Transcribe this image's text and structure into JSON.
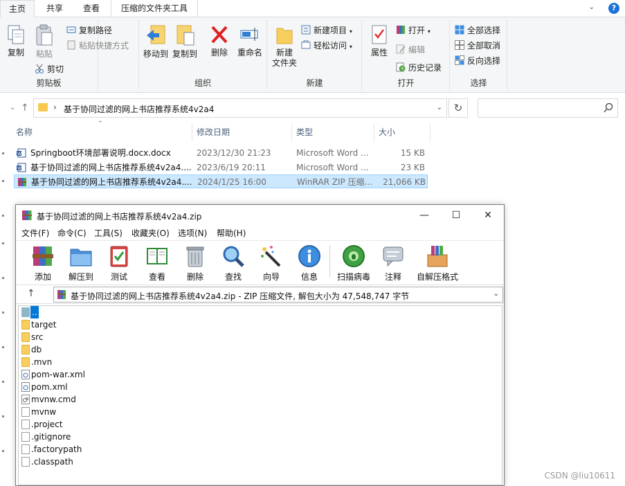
{
  "ribbon_tabs": [
    "主页",
    "共享",
    "查看",
    "压缩的文件夹工具"
  ],
  "ribbon": {
    "clipboard": {
      "copy": "复制",
      "paste": "粘贴",
      "copy_path": "复制路径",
      "paste_shortcut": "粘贴快捷方式",
      "cut": "剪切",
      "label": "剪贴板"
    },
    "organize": {
      "move_to": "移动到",
      "copy_to": "复制到",
      "delete": "删除",
      "rename": "重命名",
      "label": "组织"
    },
    "new": {
      "new_folder_line1": "新建",
      "new_folder_line2": "文件夹",
      "new_item": "新建项目",
      "easy_access": "轻松访问",
      "label": "新建"
    },
    "open": {
      "properties": "属性",
      "open": "打开",
      "edit": "编辑",
      "history": "历史记录",
      "label": "打开"
    },
    "select": {
      "select_all": "全部选择",
      "select_none": "全部取消",
      "invert": "反向选择",
      "label": "选择"
    }
  },
  "address": {
    "path": "基于协同过滤的网上书店推荐系统4v2a4",
    "separator": "›"
  },
  "columns": {
    "name": "名称",
    "modified": "修改日期",
    "type": "类型",
    "size": "大小"
  },
  "files": [
    {
      "name": "Springboot环境部署说明.docx.docx",
      "modified": "2023/12/30 21:23",
      "type": "Microsoft Word ...",
      "size": "15 KB"
    },
    {
      "name": "基于协同过滤的网上书店推荐系统4v2a4....",
      "modified": "2023/6/19 20:11",
      "type": "Microsoft Word ...",
      "size": "23 KB"
    },
    {
      "name": "基于协同过滤的网上书店推荐系统4v2a4....",
      "modified": "2024/1/25 16:00",
      "type": "WinRAR ZIP 压缩...",
      "size": "21,066 KB"
    }
  ],
  "winrar": {
    "title": "基于协同过滤的网上书店推荐系统4v2a4.zip",
    "menu": [
      "文件(F)",
      "命令(C)",
      "工具(S)",
      "收藏夹(O)",
      "选项(N)",
      "帮助(H)"
    ],
    "tools": [
      "添加",
      "解压到",
      "测试",
      "查看",
      "删除",
      "查找",
      "向导",
      "信息",
      "扫描病毒",
      "注释",
      "自解压格式"
    ],
    "path_text": "基于协同过滤的网上书店推荐系统4v2a4.zip - ZIP 压缩文件, 解包大小为 47,548,747 字节",
    "items": [
      {
        "name": "..",
        "kind": "up"
      },
      {
        "name": "target",
        "kind": "folder"
      },
      {
        "name": "src",
        "kind": "folder"
      },
      {
        "name": "db",
        "kind": "folder"
      },
      {
        "name": ".mvn",
        "kind": "folder"
      },
      {
        "name": "pom-war.xml",
        "kind": "xml"
      },
      {
        "name": "pom.xml",
        "kind": "xml"
      },
      {
        "name": "mvnw.cmd",
        "kind": "cmd"
      },
      {
        "name": "mvnw",
        "kind": "file"
      },
      {
        "name": ".project",
        "kind": "file"
      },
      {
        "name": ".gitignore",
        "kind": "file"
      },
      {
        "name": ".factorypath",
        "kind": "file"
      },
      {
        "name": ".classpath",
        "kind": "file"
      }
    ]
  },
  "watermark": "CSDN @liu10611"
}
